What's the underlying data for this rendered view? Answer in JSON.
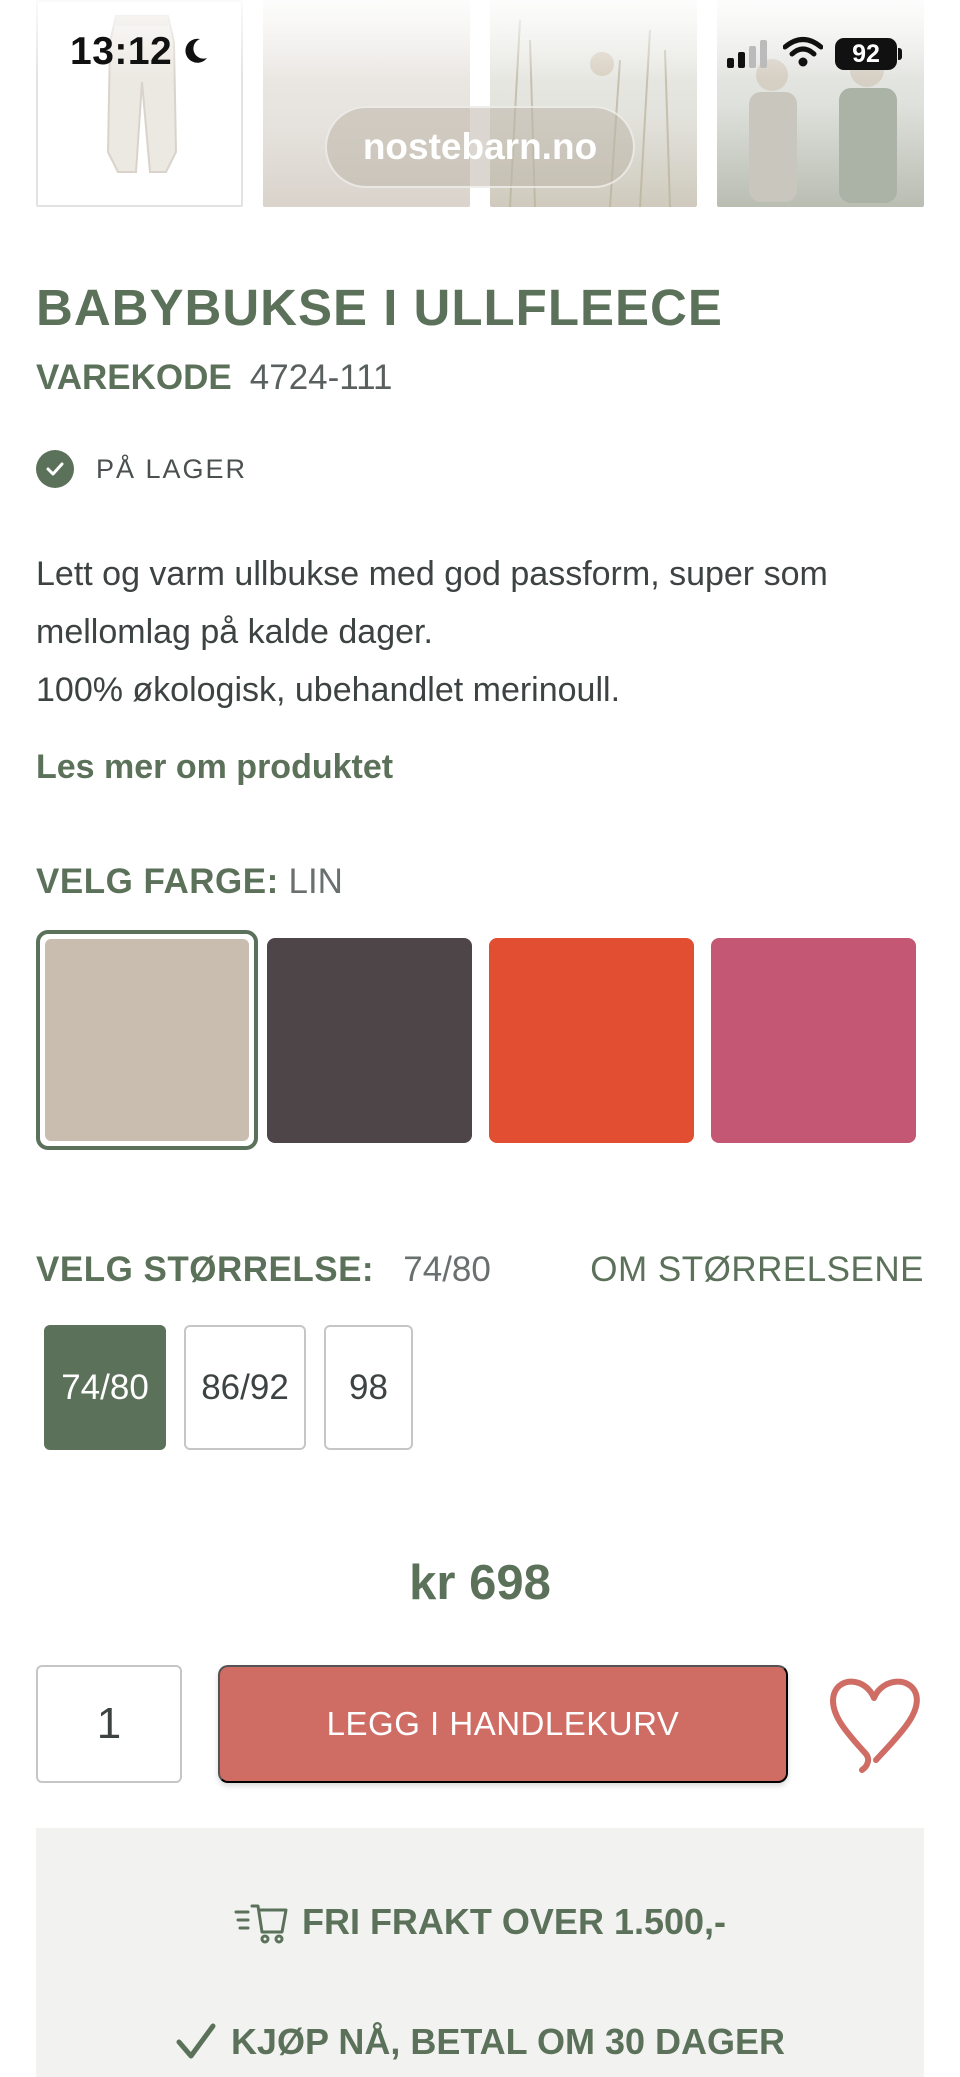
{
  "status_bar": {
    "time": "13:12",
    "battery": "92"
  },
  "browser": {
    "url": "nostebarn.no"
  },
  "thumbnails": [
    "thumb-pants",
    "thumb-field",
    "thumb-grass-child",
    "thumb-children"
  ],
  "product": {
    "title": "BABYBUKSE I ULLFLEECE",
    "code_label": "VAREKODE",
    "code": "4724-111",
    "stock": "PÅ LAGER",
    "description": [
      "Lett og varm ullbukse med god passform, super som",
      "mellomlag på kalde dager.",
      "100% økologisk, ubehandlet merinoull."
    ],
    "read_more": "Les mer om produktet"
  },
  "color": {
    "label": "VELG FARGE:",
    "selected": "LIN",
    "swatches": [
      "#c9bdb0",
      "#4d4547",
      "#e24e32",
      "#c45874"
    ]
  },
  "size": {
    "label": "VELG STØRRELSE:",
    "selected": "74/80",
    "guide": "OM STØRRELSENE",
    "options": [
      "74/80",
      "86/92",
      "98"
    ]
  },
  "price": "kr 698",
  "cart": {
    "quantity": "1",
    "add_label": "LEGG I HANDLEKURV"
  },
  "info": {
    "shipping": "FRI FRAKT OVER 1.500,-",
    "pay_later": "KJØP NÅ, BETAL OM 30 DAGER"
  },
  "colors": {
    "accent": "#5b7159",
    "cta": "#cf6c64"
  }
}
